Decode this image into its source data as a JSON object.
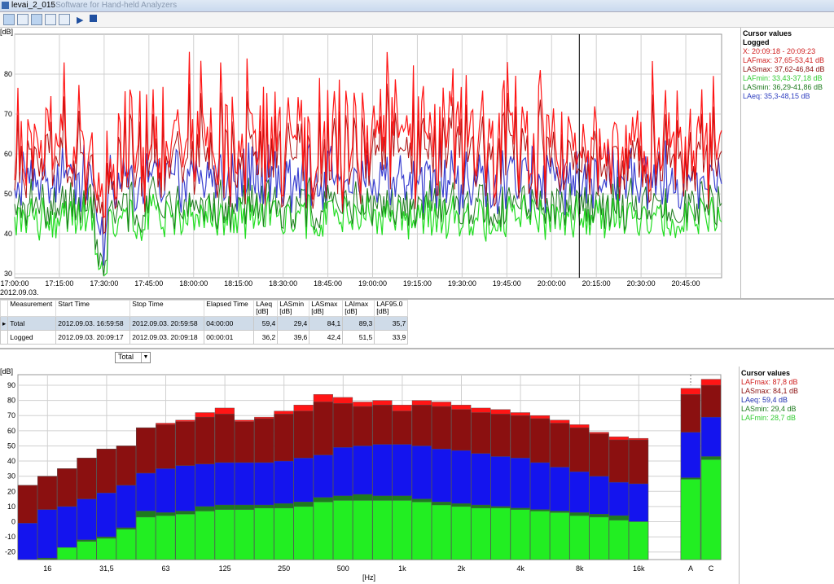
{
  "window": {
    "title": "levai_2_015",
    "subtitle": "- Software for Hand-held Analyzers"
  },
  "toolbar": {
    "buttons": [
      "graph-icon",
      "folder-graph-icon",
      "bar-chart-icon",
      "xy-graph-icon",
      "table-icon",
      "play-icon",
      "stop-icon"
    ]
  },
  "top_legend": {
    "title": "Cursor values",
    "subtitle": "Logged",
    "items": [
      {
        "text": "X: 20:09:18 - 20:09:23",
        "color": "#d02020"
      },
      {
        "text": "LAFmax: 37,65-53,41 dB",
        "color": "#d02020"
      },
      {
        "text": "LASmax: 37,62-46,84 dB",
        "color": "#8b1010"
      },
      {
        "text": "LAFmin: 33,43-37,18 dB",
        "color": "#33cc33"
      },
      {
        "text": "LASmin: 36,29-41,86 dB",
        "color": "#1e7a1e"
      },
      {
        "text": "LAeq: 35,3-48,15 dB",
        "color": "#3040c0"
      }
    ]
  },
  "bottom_legend": {
    "title": "Cursor values",
    "items": [
      {
        "text": "LAFmax: 87,8 dB",
        "color": "#d02020"
      },
      {
        "text": "LASmax: 84,1 dB",
        "color": "#8b1010"
      },
      {
        "text": "LAeq: 59,4 dB",
        "color": "#2030b0"
      },
      {
        "text": "LASmin: 29,4 dB",
        "color": "#1e7a1e"
      },
      {
        "text": "LAFmin: 28,7 dB",
        "color": "#33cc33"
      }
    ]
  },
  "table": {
    "columns": [
      "Measurement",
      "Start Time",
      "Stop Time",
      "Elapsed Time",
      "LAeq [dB]",
      "LASmin [dB]",
      "LASmax [dB]",
      "LAImax [dB]",
      "LAF95.0 [dB]"
    ],
    "rows": [
      [
        "Total",
        "2012.09.03. 16:59:58",
        "2012.09.03. 20:59:58",
        "04:00:00",
        "59,4",
        "29,4",
        "84,1",
        "89,3",
        "35,7"
      ],
      [
        "Logged",
        "2012.09.03. 20:09:17",
        "2012.09.03. 20:09:18",
        "00:00:01",
        "36,2",
        "39,6",
        "42,4",
        "51,5",
        "33,9"
      ]
    ]
  },
  "selector": {
    "value": "Total"
  },
  "chart_data": [
    {
      "type": "line",
      "ylabel": "[dB]",
      "ylim": [
        29,
        90
      ],
      "yticks": [
        30,
        40,
        50,
        60,
        70,
        80
      ],
      "xlim": [
        "17:00:00",
        "20:57:00"
      ],
      "xticks": [
        "17:00:00",
        "17:15:00",
        "17:30:00",
        "17:45:00",
        "18:00:00",
        "18:15:00",
        "18:30:00",
        "18:45:00",
        "19:00:00",
        "19:15:00",
        "19:30:00",
        "19:45:00",
        "20:00:00",
        "20:15:00",
        "20:30:00",
        "20:45:00"
      ],
      "date_label": "2012.09.03.",
      "cursor_x": "20:09:18",
      "grid": true,
      "series": [
        {
          "name": "LAFmax",
          "color": "#ff1515"
        },
        {
          "name": "LASmax",
          "color": "#b01010"
        },
        {
          "name": "LAeq",
          "color": "#3a40d0"
        },
        {
          "name": "LASmin",
          "color": "#1e7a1e"
        },
        {
          "name": "LAFmin",
          "color": "#22dd22"
        }
      ]
    },
    {
      "type": "bar",
      "ylabel": "[dB]",
      "xlabel": "[Hz]",
      "ylim": [
        -25,
        97
      ],
      "yticks": [
        -20,
        -10,
        0,
        10,
        20,
        30,
        40,
        50,
        60,
        70,
        80,
        90
      ],
      "categories": [
        "12.5",
        "16",
        "20",
        "25",
        "31.5",
        "40",
        "50",
        "63",
        "80",
        "100",
        "125",
        "160",
        "200",
        "250",
        "315",
        "400",
        "500",
        "630",
        "800",
        "1k",
        "1.25k",
        "1.6k",
        "2k",
        "2.5k",
        "3.15k",
        "4k",
        "5k",
        "6.3k",
        "8k",
        "10k",
        "12.5k",
        "16k",
        "20k"
      ],
      "category_labels": {
        "1": "16",
        "4": "31,5",
        "7": "63",
        "10": "125",
        "13": "250",
        "16": "500",
        "19": "1k",
        "22": "2k",
        "25": "4k",
        "28": "8k",
        "31": "16k"
      },
      "weighted_categories": [
        "A",
        "C"
      ],
      "series": [
        {
          "name": "LAFmax",
          "color": "#ff1515",
          "values": [
            24,
            30,
            35,
            42,
            48,
            50,
            62,
            65,
            67,
            72,
            75,
            67,
            69,
            73,
            77,
            84,
            82,
            79,
            80,
            77,
            80,
            79,
            77,
            75,
            74,
            72,
            70,
            67,
            64,
            59,
            56,
            55
          ],
          "weighted": [
            88,
            94
          ]
        },
        {
          "name": "LASmax",
          "color": "#8b1010",
          "values": [
            24,
            30,
            35,
            42,
            48,
            50,
            62,
            64,
            66,
            69,
            71,
            66,
            68,
            71,
            73,
            79,
            78,
            76,
            77,
            73,
            77,
            76,
            74,
            72,
            71,
            70,
            68,
            65,
            62,
            58,
            54,
            54
          ],
          "weighted": [
            84,
            90
          ]
        },
        {
          "name": "LAeq",
          "color": "#1414ee",
          "values": [
            -1,
            8,
            10,
            15,
            19,
            24,
            32,
            35,
            37,
            38,
            39,
            39,
            39,
            40,
            42,
            44,
            49,
            50,
            51,
            51,
            50,
            48,
            47,
            45,
            43,
            42,
            39,
            36,
            33,
            30,
            26,
            25
          ],
          "weighted": [
            59,
            69
          ]
        },
        {
          "name": "LASmin",
          "color": "#1e7a1e",
          "values": [
            -25,
            -24,
            -18,
            -12,
            -10,
            -4,
            7,
            6,
            7,
            10,
            11,
            11,
            11,
            12,
            13,
            16,
            17,
            18,
            17,
            17,
            15,
            13,
            12,
            11,
            10,
            9,
            8,
            7,
            6,
            5,
            4,
            0
          ],
          "weighted": [
            29,
            43
          ]
        },
        {
          "name": "LAFmin",
          "color": "#22ee22",
          "values": [
            -25,
            -25,
            -17,
            -13,
            -11,
            -5,
            3,
            4,
            5,
            7,
            8,
            8,
            9,
            9,
            10,
            13,
            14,
            14,
            14,
            14,
            13,
            11,
            10,
            9,
            9,
            8,
            7,
            6,
            4,
            3,
            1,
            0
          ],
          "weighted": [
            28,
            41
          ]
        }
      ]
    }
  ]
}
